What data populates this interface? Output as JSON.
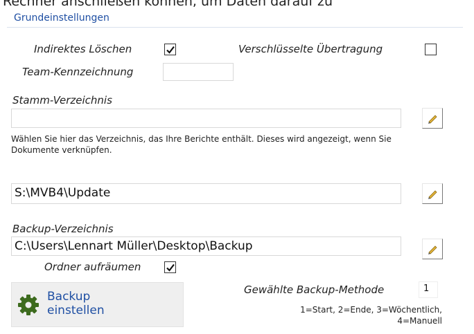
{
  "page_top_text": "Rechner anschließen können, um Daten darauf zu",
  "section_title": "Grundeinstellungen",
  "indirect_delete": {
    "label": "Indirektes Löschen",
    "checked": true
  },
  "encrypted_transfer": {
    "label": "Verschlüsselte Übertragung",
    "checked": false
  },
  "team_label": "Team-Kennzeichnung",
  "team_value": "",
  "root_dir": {
    "label": "Stamm-Verzeichnis",
    "value": ""
  },
  "root_hint": "Wählen Sie hier das Verzeichnis, das Ihre Berichte enthält. Dieses wird angezeigt, wenn Sie Dokumente verknüpfen.",
  "update_dir": {
    "value": "S:\\MVB4\\Update"
  },
  "backup_dir": {
    "label": "Backup-Verzeichnis",
    "value": "C:\\Users\\Lennart Müller\\Desktop\\Backup"
  },
  "cleanup": {
    "label": "Ordner aufräumen",
    "checked": true
  },
  "backup_button": {
    "line1": "Backup",
    "line2": "einstellen"
  },
  "backup_method": {
    "label": "Gewählte Backup-Methode",
    "value": "1",
    "legend_line1": "1=Start, 2=Ende, 3=Wöchentlich,",
    "legend_line2": "4=Manuell"
  },
  "icons": {
    "edit": "pencil-icon",
    "gear": "gear-icon",
    "check": "checkmark-icon"
  },
  "colors": {
    "accent": "#1f4fa3",
    "gear": "#3d6b1e",
    "pencil": "#e5b53a"
  }
}
